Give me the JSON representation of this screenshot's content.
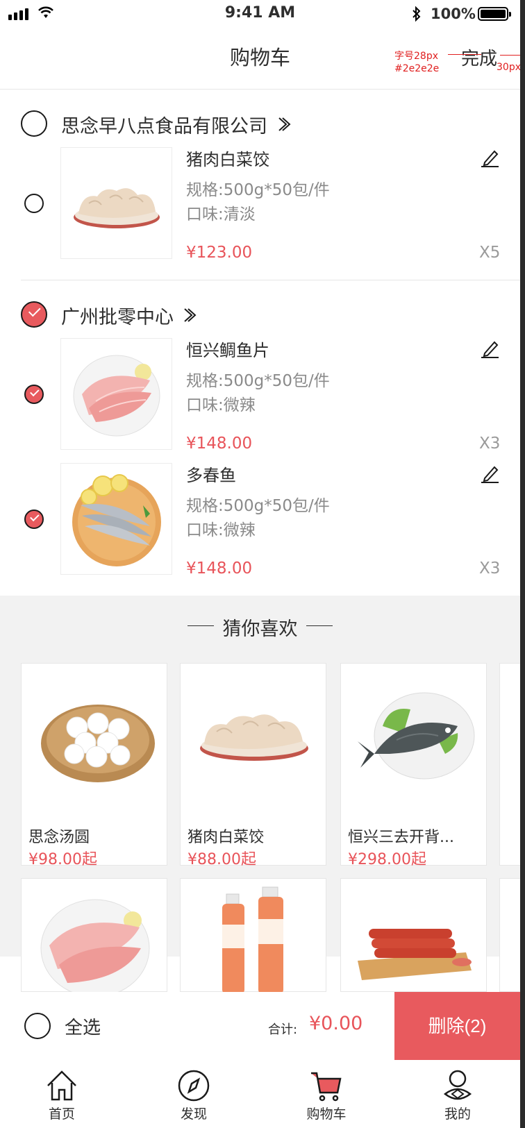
{
  "status_bar": {
    "time": "9:41 AM",
    "battery": "100%"
  },
  "nav": {
    "title": "购物车",
    "done_label": "完成"
  },
  "annotations": {
    "font_size": "字号28px",
    "color_code": "#2e2e2e",
    "spacing": "30px"
  },
  "shops": [
    {
      "name": "思念早八点食品有限公司",
      "checked": false,
      "items": [
        {
          "name": "猪肉白菜饺",
          "spec": "规格:500g*50包/件",
          "taste": "口味:清淡",
          "price": "¥123.00",
          "qty": "X5",
          "checked": false
        }
      ]
    },
    {
      "name": "广州批零中心",
      "checked": true,
      "items": [
        {
          "name": "恒兴鲷鱼片",
          "spec": "规格:500g*50包/件",
          "taste": "口味:微辣",
          "price": "¥148.00",
          "qty": "X3",
          "checked": true
        },
        {
          "name": "多春鱼",
          "spec": "规格:500g*50包/件",
          "taste": "口味:微辣",
          "price": "¥148.00",
          "qty": "X3",
          "checked": true
        }
      ]
    }
  ],
  "recommend": {
    "title": "猜你喜欢",
    "products": [
      {
        "name": "思念汤圆",
        "price": "¥98.00起",
        "icon": "tangyuan"
      },
      {
        "name": "猪肉白菜饺",
        "price": "¥88.00起",
        "icon": "dumplings"
      },
      {
        "name": "恒兴三去开背...",
        "price": "¥298.00起",
        "icon": "fish"
      },
      {
        "name": "",
        "price": "",
        "icon": "fish-fillet"
      },
      {
        "name": "",
        "price": "",
        "icon": "juice"
      },
      {
        "name": "",
        "price": "",
        "icon": "sausage"
      }
    ]
  },
  "bottom": {
    "select_all": "全选",
    "total_label": "合计:",
    "total_value": "¥0.00",
    "delete_label": "删除(2)"
  },
  "tabbar": [
    {
      "label": "首页",
      "icon": "home-icon",
      "active": false
    },
    {
      "label": "发现",
      "icon": "compass-icon",
      "active": false
    },
    {
      "label": "购物车",
      "icon": "cart-icon",
      "active": true
    },
    {
      "label": "我的",
      "icon": "user-icon",
      "active": false
    }
  ],
  "colors": {
    "accent": "#e85a5e",
    "text": "#2e2e2e",
    "muted": "#8a8a8a",
    "bg_gray": "#f2f2f2"
  }
}
